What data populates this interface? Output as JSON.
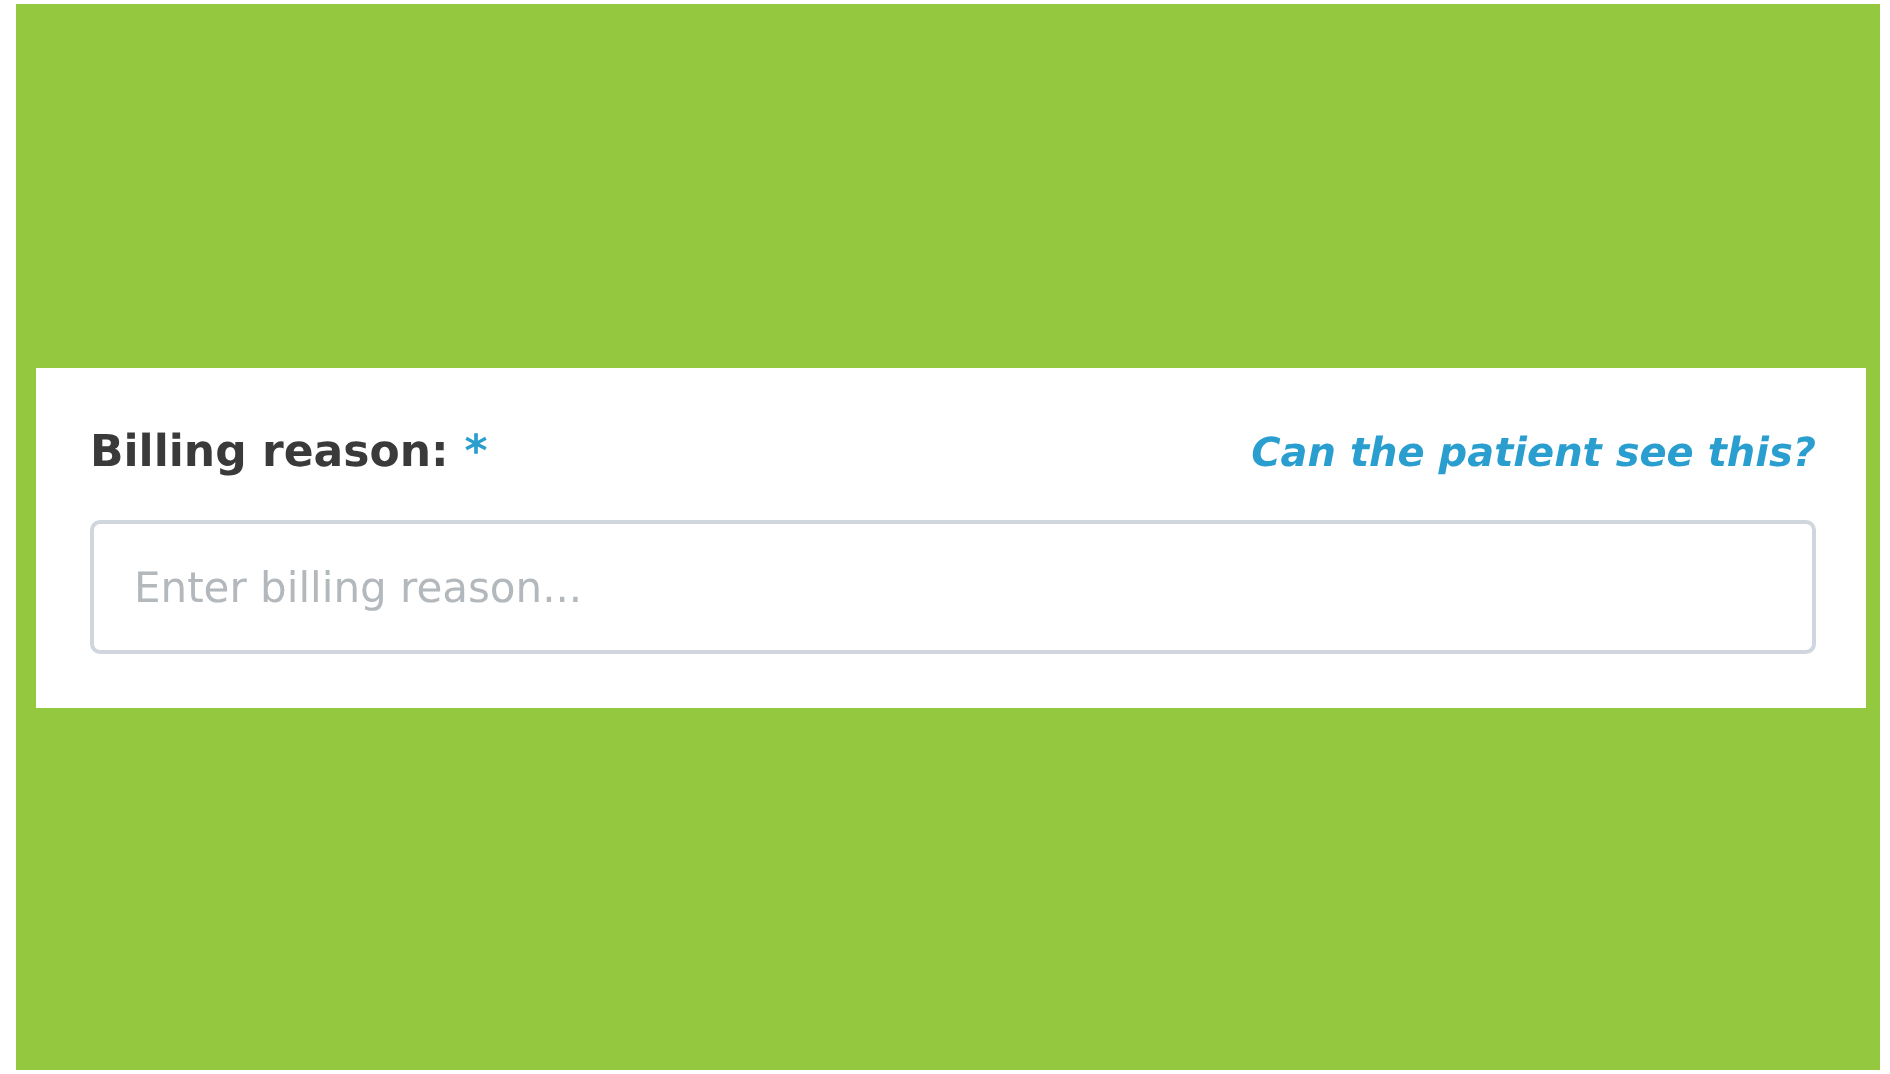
{
  "field": {
    "label": "Billing reason:",
    "required_mark": "*",
    "help_link": "Can the patient see this?",
    "placeholder": "Enter billing reason..."
  }
}
